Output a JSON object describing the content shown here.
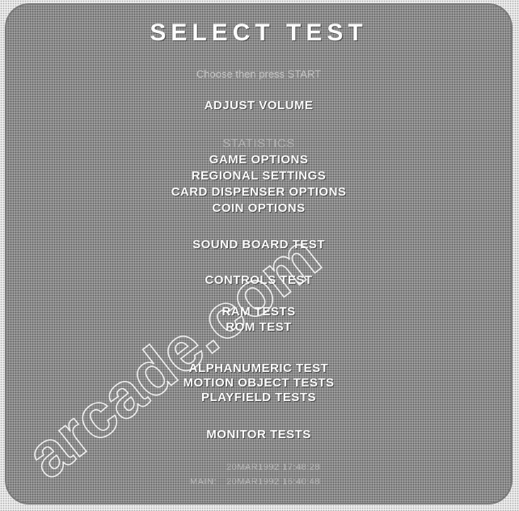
{
  "screen": {
    "title": "SELECT TEST",
    "instruction": "Choose then press START"
  },
  "menu": {
    "items": [
      {
        "label": "ADJUST VOLUME",
        "dim": false
      },
      {
        "label": "STATISTICS",
        "dim": true
      },
      {
        "label": "GAME OPTIONS",
        "dim": false
      },
      {
        "label": "REGIONAL SETTINGS",
        "dim": false
      },
      {
        "label": "CARD DISPENSER OPTIONS",
        "dim": false
      },
      {
        "label": "COIN OPTIONS",
        "dim": false
      },
      {
        "label": "SOUND BOARD TEST",
        "dim": false
      },
      {
        "label": "CONTROLS TEST",
        "dim": false
      },
      {
        "label": "RAM TESTS",
        "dim": false
      },
      {
        "label": "ROM TEST",
        "dim": false
      },
      {
        "label": "ALPHANUMERIC TEST",
        "dim": false
      },
      {
        "label": "MOTION OBJECT TESTS",
        "dim": false
      },
      {
        "label": "PLAYFIELD TESTS",
        "dim": false
      },
      {
        "label": "MONITOR TESTS",
        "dim": false
      }
    ]
  },
  "footer": {
    "lines": [
      {
        "label": "",
        "value": "20MAR1992 17:48:28"
      },
      {
        "label": "MAIN:",
        "value": "20MAR1992 16:40:48"
      }
    ]
  },
  "watermark": {
    "text": "arcade.com"
  },
  "colors": {
    "screen_bg": "#979797",
    "text": "#fbfbfb",
    "dim_text": "#b3b3b3"
  }
}
